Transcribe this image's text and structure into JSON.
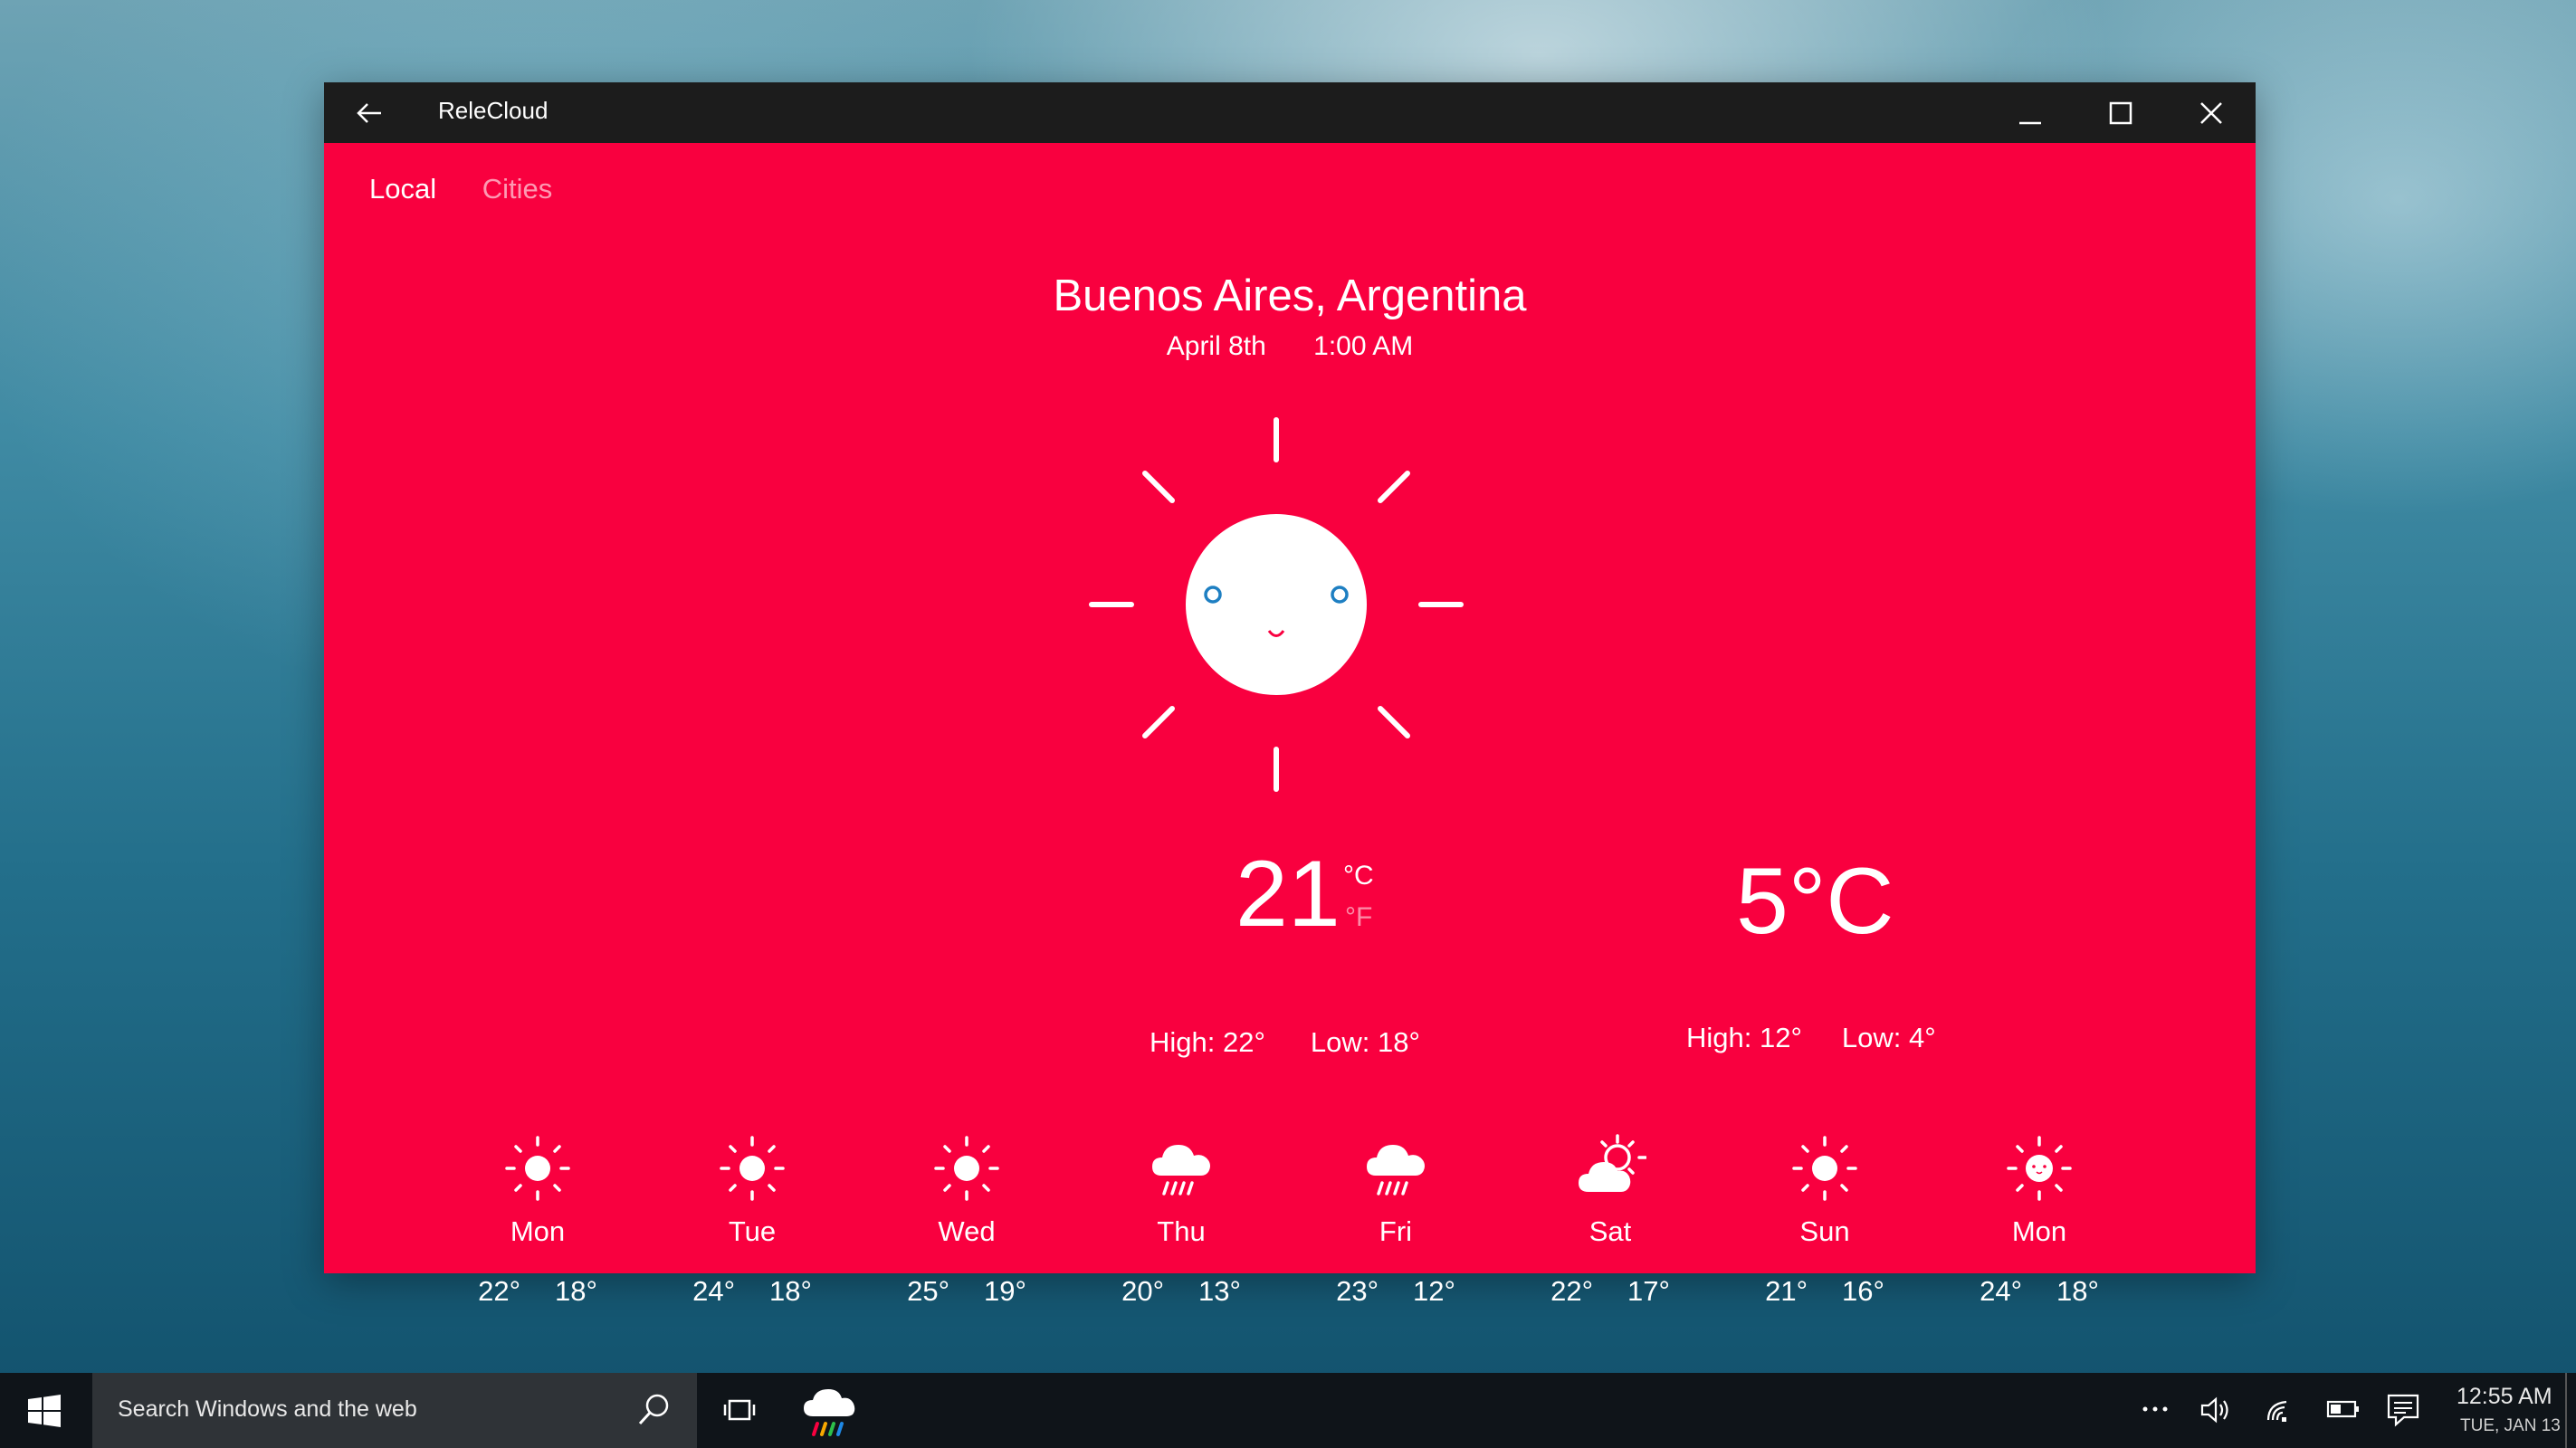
{
  "window": {
    "title": "ReleCloud",
    "background_color": "#f9003f",
    "titlebar_color": "#1c1c1c",
    "icons": {
      "back": "back-arrow-icon",
      "minimize": "minimize-icon",
      "maximize": "maximize-icon",
      "close": "close-icon"
    }
  },
  "tabs": [
    {
      "label": "Local",
      "selected": true
    },
    {
      "label": "Cities",
      "selected": false
    }
  ],
  "location": {
    "city": "Buenos Aires, Argentina",
    "date": "April 8th",
    "time": "1:00 AM"
  },
  "current": {
    "icon": "smiling-sun-icon",
    "temperature": "21",
    "unit_celsius": "°C",
    "unit_fahrenheit": "°F",
    "selected_unit": "°C",
    "high": "High: 22°",
    "low": "Low: 18°"
  },
  "secondary": {
    "temperature": "5°C",
    "high": "High: 12°",
    "low": "Low: 4°"
  },
  "forecast": [
    {
      "day": "Mon",
      "high": "22°",
      "low": "18°",
      "icon": "sun-icon"
    },
    {
      "day": "Tue",
      "high": "24°",
      "low": "18°",
      "icon": "sun-icon"
    },
    {
      "day": "Wed",
      "high": "25°",
      "low": "19°",
      "icon": "sun-icon"
    },
    {
      "day": "Thu",
      "high": "20°",
      "low": "13°",
      "icon": "rain-cloud-icon"
    },
    {
      "day": "Fri",
      "high": "23°",
      "low": "12°",
      "icon": "rain-cloud-icon"
    },
    {
      "day": "Sat",
      "high": "22°",
      "low": "17°",
      "icon": "partly-cloudy-icon"
    },
    {
      "day": "Sun",
      "high": "21°",
      "low": "16°",
      "icon": "sun-icon"
    },
    {
      "day": "Mon",
      "high": "24°",
      "low": "18°",
      "icon": "smiling-sun-icon"
    }
  ],
  "taskbar": {
    "search_placeholder": "Search Windows and the web",
    "clock_time": "12:55 AM",
    "clock_date": "TUE, JAN 13",
    "background_color": "#0f1419",
    "icons": [
      "windows-start-icon",
      "search-icon",
      "task-view-icon",
      "relecloud-app-icon",
      "more-dots-icon",
      "volume-icon",
      "network-icon",
      "battery-icon",
      "action-center-icon"
    ]
  }
}
